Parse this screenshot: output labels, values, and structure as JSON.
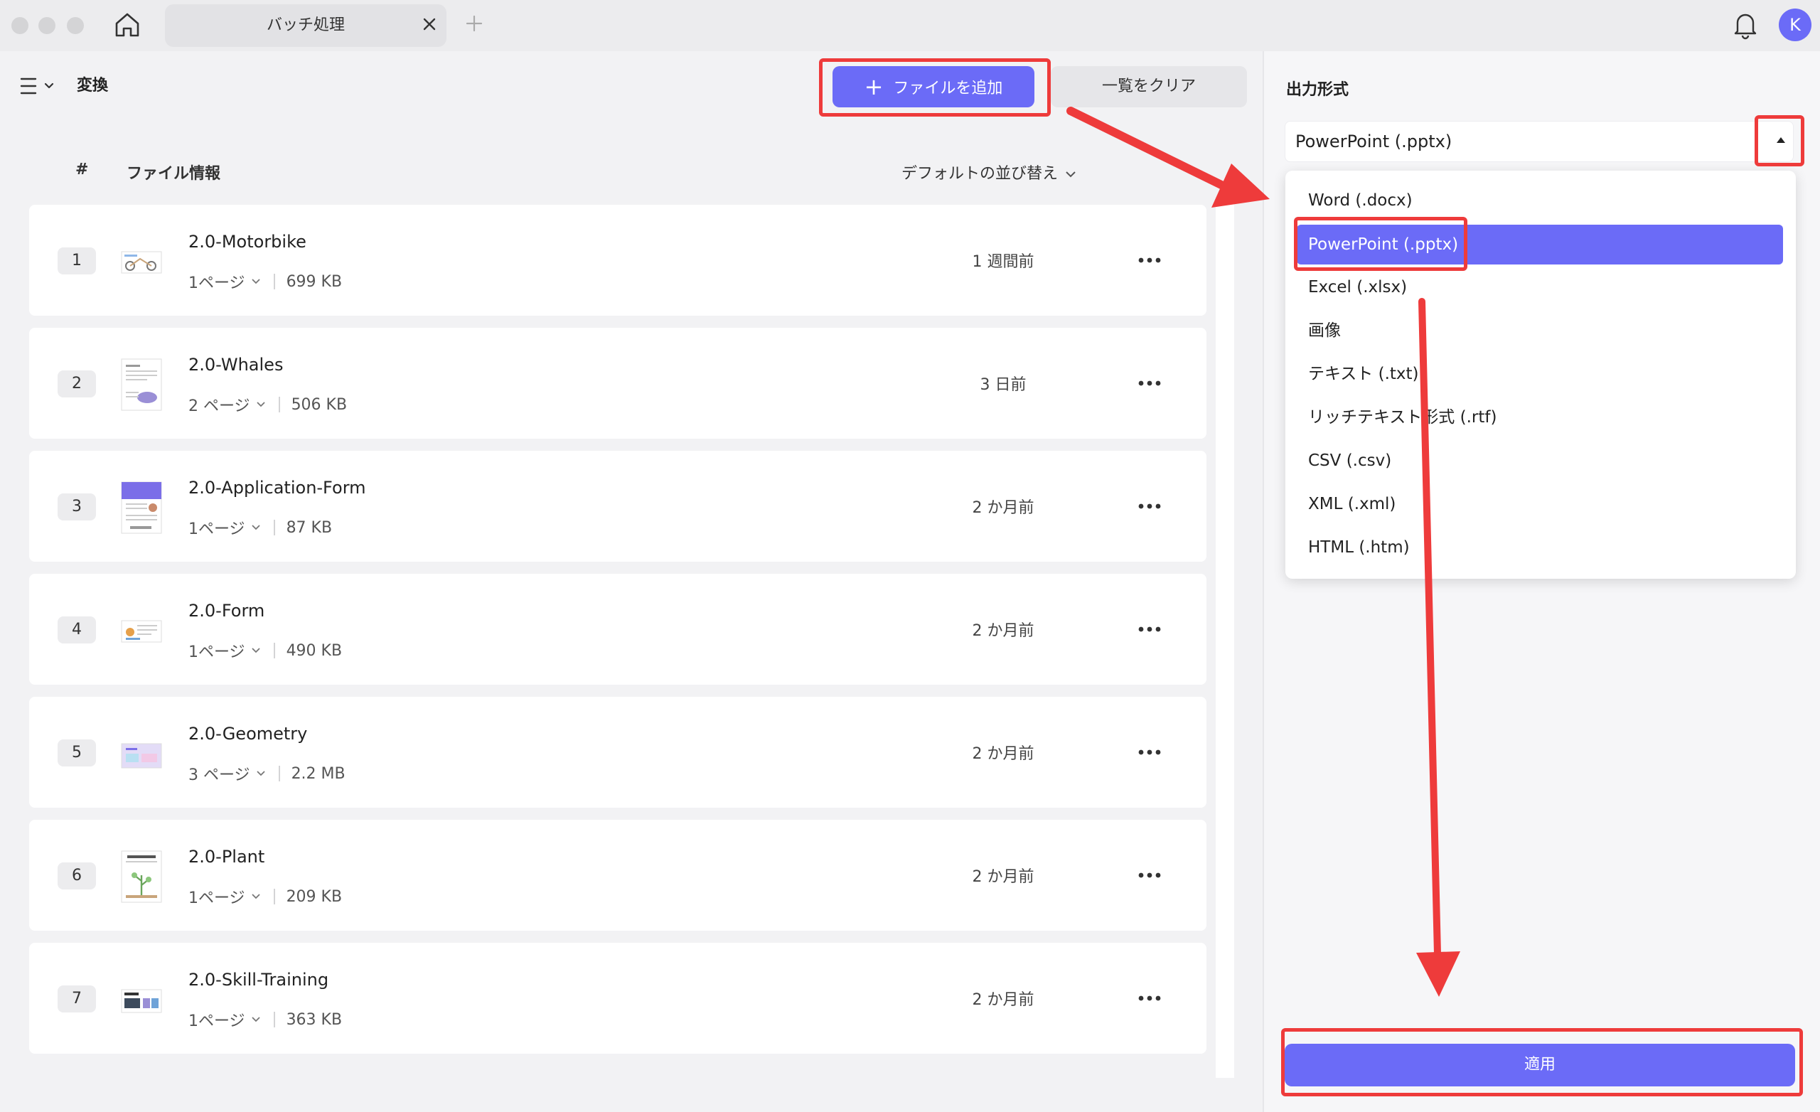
{
  "window": {
    "tab_title": "バッチ処理",
    "avatar_initial": "K"
  },
  "toolbar": {
    "title": "変換",
    "add_files_label": "ファイルを追加",
    "clear_list_label": "一覧をクリア"
  },
  "table": {
    "col_number": "#",
    "col_file_info": "ファイル情報",
    "sort_label": "デフォルトの並び替え"
  },
  "files": [
    {
      "num": "1",
      "name": "2.0-Motorbike",
      "pages": "1ページ",
      "size": "699 KB",
      "date": "1 週間前"
    },
    {
      "num": "2",
      "name": "2.0-Whales",
      "pages": "2 ページ",
      "size": "506 KB",
      "date": "3 日前"
    },
    {
      "num": "3",
      "name": "2.0-Application-Form",
      "pages": "1ページ",
      "size": "87 KB",
      "date": "2 か月前"
    },
    {
      "num": "4",
      "name": "2.0-Form",
      "pages": "1ページ",
      "size": "490 KB",
      "date": "2 か月前"
    },
    {
      "num": "5",
      "name": "2.0-Geometry",
      "pages": "3 ページ",
      "size": "2.2 MB",
      "date": "2 か月前"
    },
    {
      "num": "6",
      "name": "2.0-Plant",
      "pages": "1ページ",
      "size": "209 KB",
      "date": "2 か月前"
    },
    {
      "num": "7",
      "name": "2.0-Skill-Training",
      "pages": "1ページ",
      "size": "363 KB",
      "date": "2 か月前"
    }
  ],
  "output": {
    "label": "出力形式",
    "selected": "PowerPoint (.pptx)",
    "options": [
      "Word (.docx)",
      "PowerPoint (.pptx)",
      "Excel (.xlsx)",
      "画像",
      "テキスト (.txt)",
      "リッチテキスト形式 (.rtf)",
      "CSV (.csv)",
      "XML (.xml)",
      "HTML (.htm)"
    ],
    "apply_label": "適用"
  },
  "colors": {
    "accent": "#6b6bf7",
    "annotation": "#ee3b3b"
  }
}
